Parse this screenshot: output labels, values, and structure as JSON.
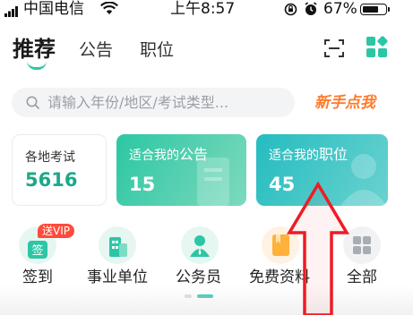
{
  "status_bar": {
    "carrier": "中国电信",
    "time": "上午8:57",
    "battery": "67%",
    "battery_level": 0.67
  },
  "tabs": {
    "active": "推荐",
    "items": [
      "公告",
      "职位"
    ]
  },
  "header_icons": [
    "scan-icon",
    "apps-grid-icon"
  ],
  "search": {
    "placeholder": "请输入年份/地区/考试类型...",
    "newbie_link": "新手点我"
  },
  "cards": {
    "exams": {
      "title": "各地考试",
      "value": "5616"
    },
    "announcements": {
      "title_prefix": "适合我的",
      "title_main": "公告",
      "value": "15"
    },
    "positions": {
      "title_prefix": "适合我的",
      "title_main": "职位",
      "value": "45"
    }
  },
  "shortcuts": [
    {
      "label": "签到",
      "icon": "sign-in-icon",
      "badge": "送VIP",
      "icon_text": "签"
    },
    {
      "label": "事业单位",
      "icon": "institution-building-icon"
    },
    {
      "label": "公务员",
      "icon": "civil-servant-icon"
    },
    {
      "label": "免费资料",
      "icon": "free-material-icon"
    },
    {
      "label": "全部",
      "icon": "all-grid-icon"
    }
  ],
  "pager": {
    "count": 2,
    "active_index": 1
  },
  "colors": {
    "accent_green": "#2cc6a6",
    "card_green": "#2cc7a3",
    "card_teal": "#25bcc0",
    "newbie_orange": "#ff7a2c",
    "badge_red": "#ff4b3a",
    "overlay_arrow_red": "#ee1c25"
  }
}
